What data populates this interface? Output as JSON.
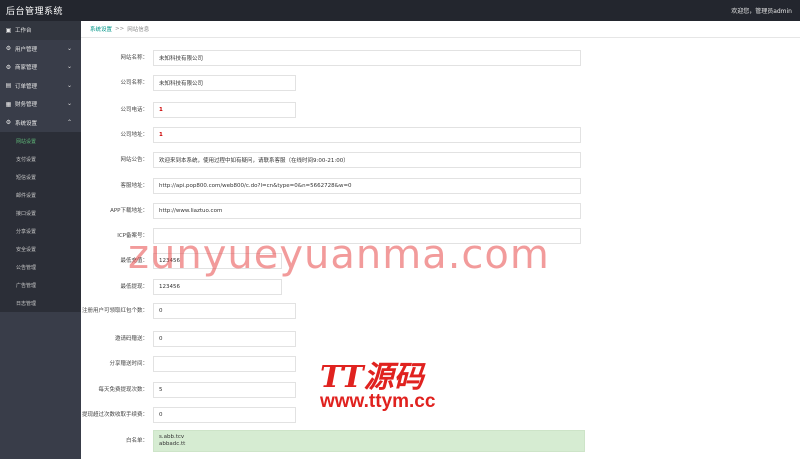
{
  "header": {
    "title": "后台管理系统",
    "welcome": "欢迎您，管理员admin"
  },
  "sidebar": {
    "items": [
      {
        "icon": "home-icon",
        "glyph": "▣",
        "label": "工作台",
        "chevron": ""
      },
      {
        "icon": "settings-icon",
        "glyph": "⚙",
        "label": "用户管理",
        "chevron": "⌄"
      },
      {
        "icon": "settings-icon",
        "glyph": "⚙",
        "label": "商家管理",
        "chevron": "⌄"
      },
      {
        "icon": "grid-icon",
        "glyph": "▤",
        "label": "订单管理",
        "chevron": "⌄"
      },
      {
        "icon": "document-icon",
        "glyph": "▦",
        "label": "财务管理",
        "chevron": "⌄"
      },
      {
        "icon": "settings-icon",
        "glyph": "⚙",
        "label": "系统设置",
        "chevron": "⌃"
      }
    ],
    "subitems": [
      {
        "label": "网站设置"
      },
      {
        "label": "支付设置"
      },
      {
        "label": "短信设置"
      },
      {
        "label": "邮件设置"
      },
      {
        "label": "接口设置"
      },
      {
        "label": "分享设置"
      },
      {
        "label": "安全设置"
      },
      {
        "label": "公告管理"
      },
      {
        "label": "广告管理"
      },
      {
        "label": "日志管理"
      }
    ]
  },
  "breadcrumb": {
    "home": "系统设置",
    "separator": ">>",
    "current": "网站信息"
  },
  "form": {
    "rows": [
      {
        "label": "网站名称：",
        "value": "未知科技有限公司"
      },
      {
        "label": "公司名称：",
        "value": "未知科技有限公司"
      },
      {
        "label": "公司电话：",
        "value": "1"
      },
      {
        "label": "公司地址：",
        "value": "1"
      },
      {
        "label": "网站公告：",
        "value": "欢迎来到本系统，使用过程中如有疑问，请联系客服（在线时间9:00-21:00）"
      },
      {
        "label": "客服地址：",
        "value": "http://api.pop800.com/web800/c.do?l=cn&type=0&n=5662728&w=0"
      },
      {
        "label": "APP下载地址：",
        "value": "http://www.liaztuo.com"
      },
      {
        "label": "ICP备案号：",
        "value": ""
      },
      {
        "label": "最低充值：",
        "value": "123456"
      },
      {
        "label": "最低提现：",
        "value": "123456"
      },
      {
        "label": "注册用户可领取红包个数：",
        "value": "0"
      },
      {
        "label": "邀请码赠送：",
        "value": "0"
      },
      {
        "label": "分享赠送时间：",
        "value": ""
      },
      {
        "label": "每天免费提现次数：",
        "value": "5"
      },
      {
        "label": "提现超过次数收取手续费：",
        "value": "0"
      },
      {
        "label": "白名单：",
        "lines": [
          "s.abb.tcv",
          "abbadc.tt"
        ]
      }
    ]
  },
  "watermark": {
    "text": "zunyueyuanma.com",
    "logo": "TT源码",
    "url": "www.ttym.cc"
  }
}
